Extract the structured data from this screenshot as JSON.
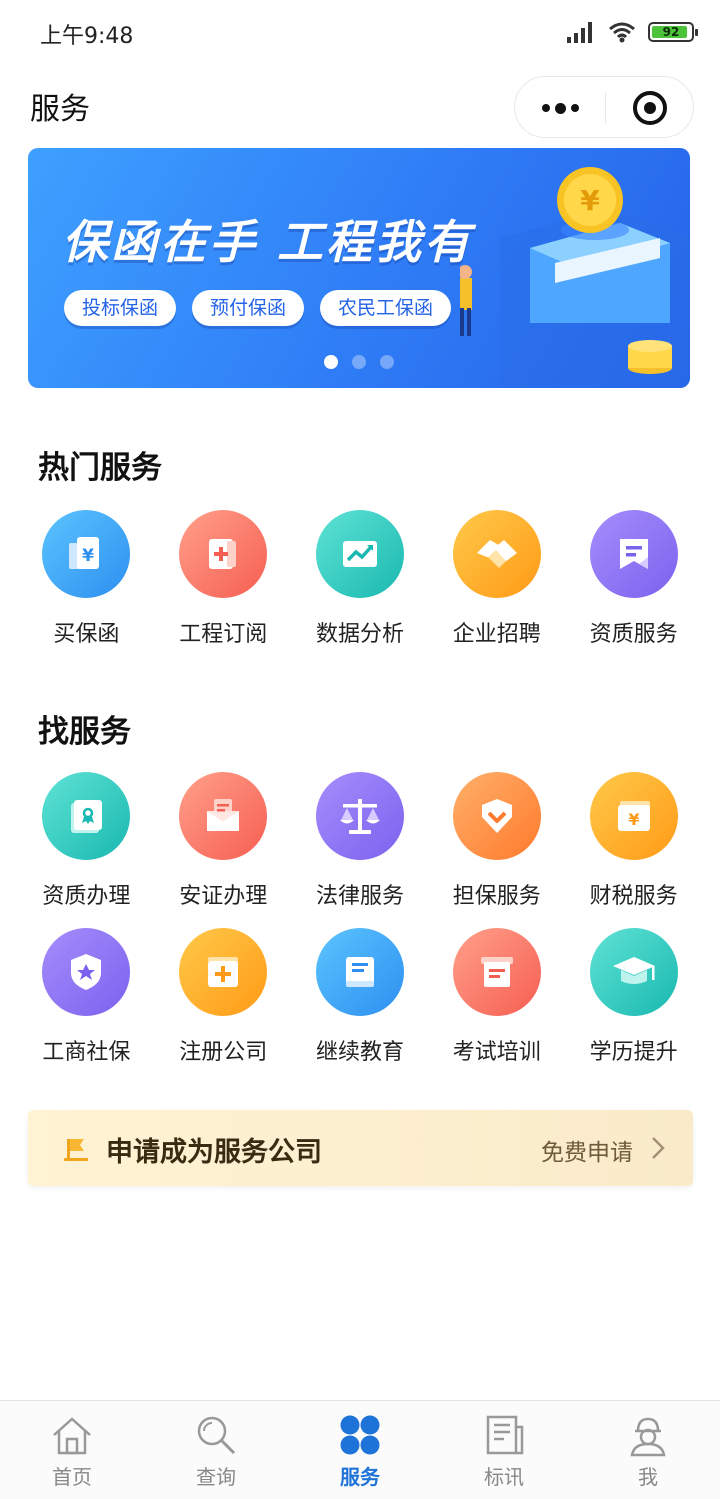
{
  "status_bar": {
    "time": "上午9:48",
    "battery": "92",
    "battery_level": 0.92
  },
  "nav": {
    "title": "服务"
  },
  "banner": {
    "slogan": "保函在手 工程我有",
    "tags": [
      "投标保函",
      "预付保函",
      "农民工保函"
    ],
    "page_count": 3,
    "active_page": 1
  },
  "hot_services": {
    "title": "热门服务",
    "items": [
      {
        "label": "买保函",
        "icon": "receipt-yuan-icon",
        "color": "#2d8ff0"
      },
      {
        "label": "工程订阅",
        "icon": "plus-document-icon",
        "color": "#f65e52"
      },
      {
        "label": "数据分析",
        "icon": "chart-trend-icon",
        "color": "#19b8b0"
      },
      {
        "label": "企业招聘",
        "icon": "handshake-icon",
        "color": "#ff9a16"
      },
      {
        "label": "资质服务",
        "icon": "document-flag-icon",
        "color": "#7b62ee"
      }
    ]
  },
  "find_services": {
    "title": "找服务",
    "items": [
      {
        "label": "资质办理",
        "icon": "certificate-icon",
        "color": "#19b8b0"
      },
      {
        "label": "安证办理",
        "icon": "envelope-icon",
        "color": "#f65e52"
      },
      {
        "label": "法律服务",
        "icon": "scales-icon",
        "color": "#7b62ee"
      },
      {
        "label": "担保服务",
        "icon": "shield-chevron-icon",
        "color": "#ff7a2c"
      },
      {
        "label": "财税服务",
        "icon": "wallet-yuan-icon",
        "color": "#ff9a16"
      },
      {
        "label": "工商社保",
        "icon": "badge-star-icon",
        "color": "#7b62ee"
      },
      {
        "label": "注册公司",
        "icon": "add-box-icon",
        "color": "#ff9a16"
      },
      {
        "label": "继续教育",
        "icon": "book-icon",
        "color": "#2d8ff0"
      },
      {
        "label": "考试培训",
        "icon": "exam-paper-icon",
        "color": "#f65e52"
      },
      {
        "label": "学历提升",
        "icon": "graduation-cap-icon",
        "color": "#19b8b0"
      }
    ]
  },
  "apply_card": {
    "title": "申请成为服务公司",
    "link": "免费申请"
  },
  "tabs": [
    {
      "label": "首页",
      "icon": "home-icon",
      "active": false
    },
    {
      "label": "查询",
      "icon": "search-icon",
      "active": false
    },
    {
      "label": "服务",
      "icon": "grid-four-icon",
      "active": true
    },
    {
      "label": "标讯",
      "icon": "news-icon",
      "active": false
    },
    {
      "label": "我",
      "icon": "profile-icon",
      "active": false
    }
  ],
  "colors": {
    "accent": "#1e73d8",
    "banner": "#2f7cf6",
    "apply_bg": "#fff3d4"
  }
}
